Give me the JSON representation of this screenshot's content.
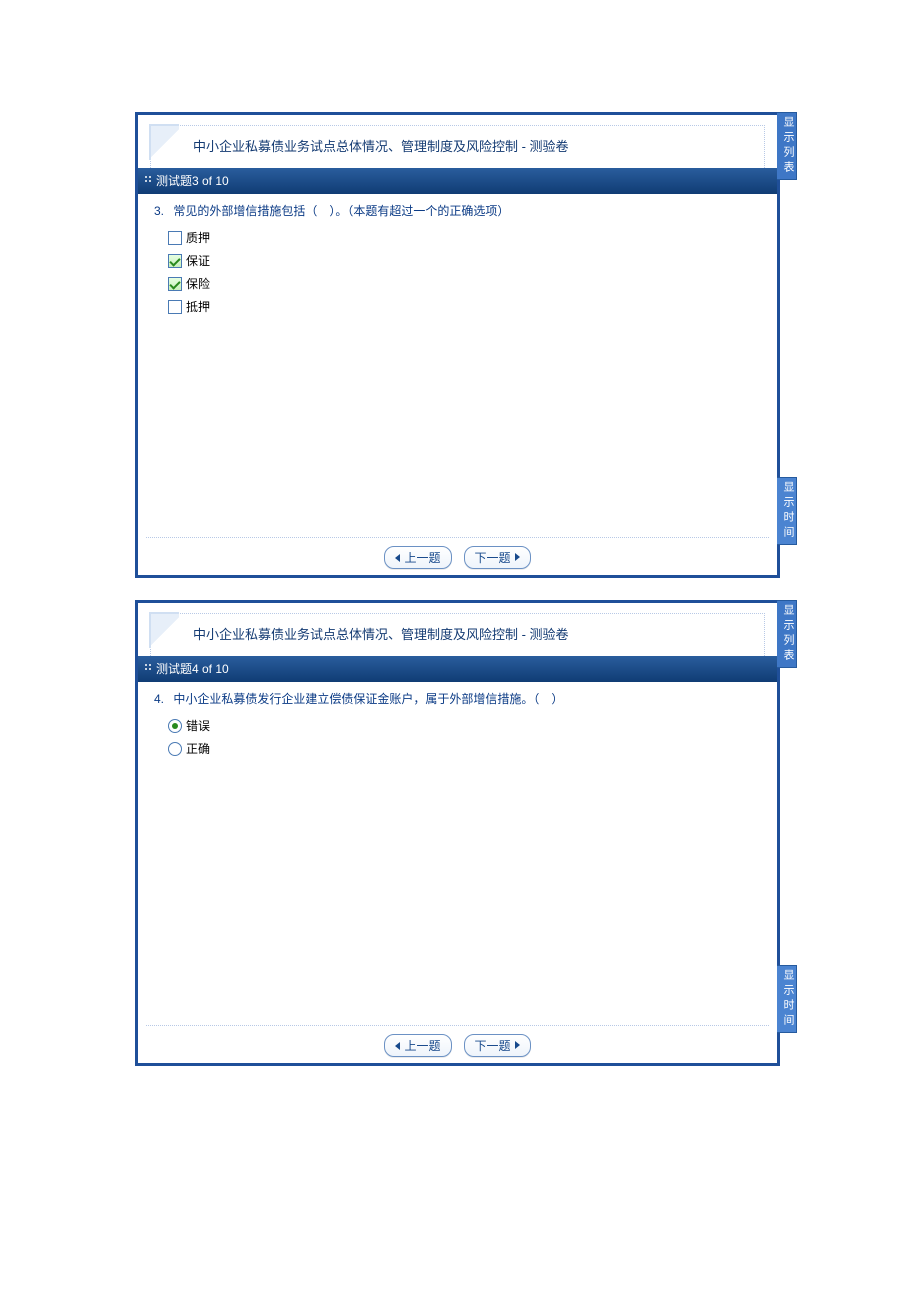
{
  "quiz_title": "中小企业私募债业务试点总体情况、管理制度及风险控制 - 测验卷",
  "side_tabs": {
    "list": "显示列表",
    "time": "显示时间"
  },
  "nav": {
    "prev": "上一题",
    "next": "下一题"
  },
  "panels": [
    {
      "counter": "测试题3 of 10",
      "number": "3.",
      "text": "常见的外部增信措施包括（　）。（本题有超过一个的正确选项）",
      "type": "checkbox",
      "options": [
        {
          "label": "质押",
          "checked": false
        },
        {
          "label": "保证",
          "checked": true
        },
        {
          "label": "保险",
          "checked": true
        },
        {
          "label": "抵押",
          "checked": false
        }
      ]
    },
    {
      "counter": "测试题4 of 10",
      "number": "4.",
      "text": "中小企业私募债发行企业建立偿债保证金账户，属于外部增信措施。（　）",
      "type": "radio",
      "options": [
        {
          "label": "错误",
          "checked": true
        },
        {
          "label": "正确",
          "checked": false
        }
      ]
    }
  ]
}
